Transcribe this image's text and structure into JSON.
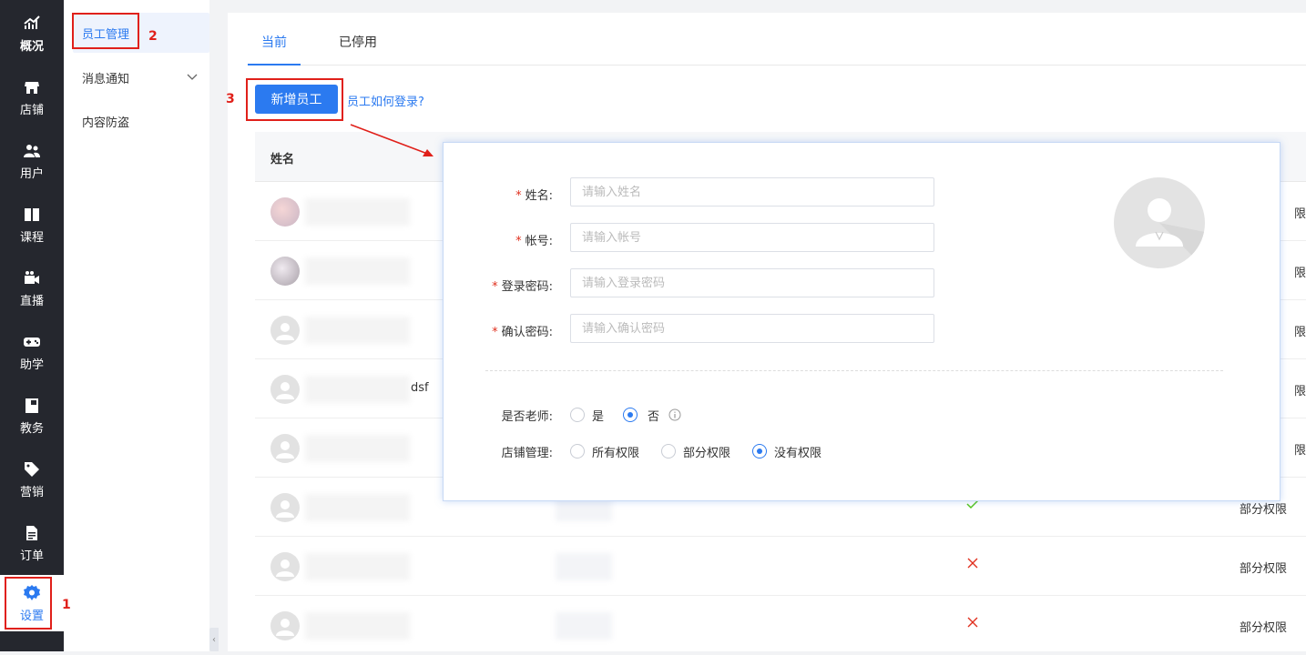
{
  "nav": {
    "items": [
      {
        "label": "概况",
        "icon": "chart-trend-icon"
      },
      {
        "label": "店铺",
        "icon": "store-icon"
      },
      {
        "label": "用户",
        "icon": "users-icon"
      },
      {
        "label": "课程",
        "icon": "book-icon"
      },
      {
        "label": "直播",
        "icon": "video-camera-icon"
      },
      {
        "label": "助学",
        "icon": "gamepad-icon"
      },
      {
        "label": "教务",
        "icon": "notebook-icon"
      },
      {
        "label": "营销",
        "icon": "tag-icon"
      },
      {
        "label": "订单",
        "icon": "document-icon"
      },
      {
        "label": "设置",
        "icon": "gear-icon"
      }
    ]
  },
  "subnav": {
    "items": [
      {
        "label": "员工管理"
      },
      {
        "label": "消息通知"
      },
      {
        "label": "内容防盗"
      }
    ]
  },
  "tabs": [
    {
      "label": "当前"
    },
    {
      "label": "已停用"
    }
  ],
  "toolbar": {
    "add_button": "新增员工",
    "help_link": "员工如何登录?"
  },
  "table": {
    "header_name": "姓名",
    "rows": [
      {
        "name_suffix": "",
        "mark": "",
        "perm": "限"
      },
      {
        "name_suffix": "",
        "mark": "",
        "perm": "限"
      },
      {
        "name_suffix": "",
        "mark": "",
        "perm": "限"
      },
      {
        "name_suffix": "dsf",
        "mark": "",
        "perm": "限"
      },
      {
        "name_suffix": "",
        "mark": "",
        "perm": "限"
      },
      {
        "name_suffix": "",
        "mark": "check",
        "perm": "部分权限"
      },
      {
        "name_suffix": "",
        "mark": "cross",
        "perm": "部分权限"
      },
      {
        "name_suffix": "",
        "mark": "cross",
        "perm": "部分权限"
      }
    ]
  },
  "dialog": {
    "fields": [
      {
        "label": "姓名:",
        "placeholder": "请输入姓名"
      },
      {
        "label": "帐号:",
        "placeholder": "请输入帐号"
      },
      {
        "label": "登录密码:",
        "placeholder": "请输入登录密码"
      },
      {
        "label": "确认密码:",
        "placeholder": "请输入确认密码"
      }
    ],
    "teacher": {
      "label": "是否老师:",
      "options": [
        "是",
        "否"
      ],
      "selected": "否"
    },
    "store": {
      "label": "店铺管理:",
      "options": [
        "所有权限",
        "部分权限",
        "没有权限"
      ],
      "selected": "没有权限"
    }
  },
  "annotations": {
    "steps": [
      "1",
      "2",
      "3"
    ],
    "accent": "#e0201a"
  },
  "colors": {
    "primary": "#2b7af0",
    "nav_bg": "#25272e",
    "success": "#52c41a",
    "danger": "#e0301e"
  }
}
